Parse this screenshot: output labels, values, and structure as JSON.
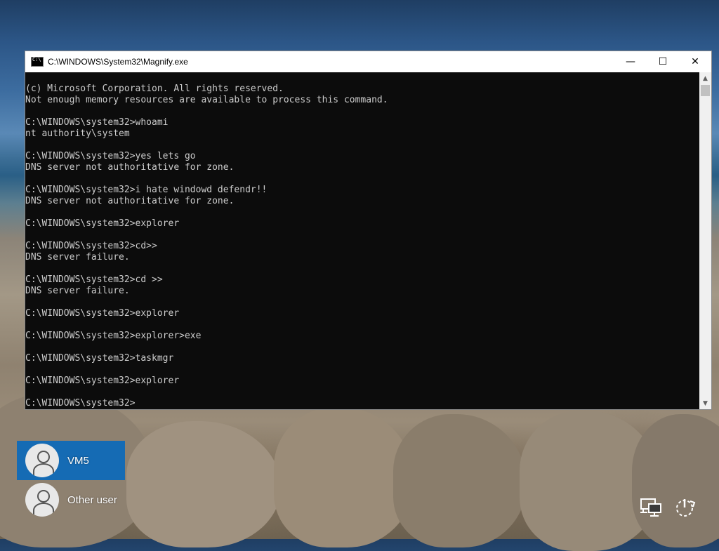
{
  "window": {
    "title": "C:\\WINDOWS\\System32\\Magnify.exe",
    "controls": {
      "minimize": "—",
      "maximize": "☐",
      "close": "✕"
    }
  },
  "console": {
    "lines": [
      "(c) Microsoft Corporation. All rights reserved.",
      "Not enough memory resources are available to process this command.",
      "",
      "C:\\WINDOWS\\system32>whoami",
      "nt authority\\system",
      "",
      "C:\\WINDOWS\\system32>yes lets go",
      "DNS server not authoritative for zone.",
      "",
      "C:\\WINDOWS\\system32>i hate windowd defendr!!",
      "DNS server not authoritative for zone.",
      "",
      "C:\\WINDOWS\\system32>explorer",
      "",
      "C:\\WINDOWS\\system32>cd>>",
      "DNS server failure.",
      "",
      "C:\\WINDOWS\\system32>cd >>",
      "DNS server failure.",
      "",
      "C:\\WINDOWS\\system32>explorer",
      "",
      "C:\\WINDOWS\\system32>explorer>exe",
      "",
      "C:\\WINDOWS\\system32>taskmgr",
      "",
      "C:\\WINDOWS\\system32>explorer",
      "",
      "C:\\WINDOWS\\system32>"
    ]
  },
  "users": [
    {
      "name": "VM5",
      "selected": true
    },
    {
      "name": "Other user",
      "selected": false
    }
  ],
  "tray": {
    "network_icon": "network-icon",
    "power_icon": "power-icon"
  },
  "colors": {
    "console_bg": "#0c0c0c",
    "console_text": "#cccccc",
    "selection": "#0067c0"
  }
}
